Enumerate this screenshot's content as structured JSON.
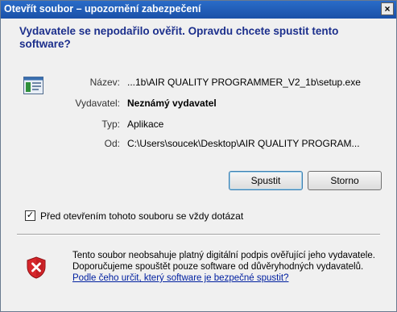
{
  "window": {
    "title": "Otevřít soubor – upozornění zabezpečení",
    "close_glyph": "×"
  },
  "question": "Vydavatele se nepodařilo ověřit. Opravdu chcete spustit tento software?",
  "details": {
    "name_label": "Název:",
    "name_value": "...1b\\AIR QUALITY PROGRAMMER_V2_1b\\setup.exe",
    "publisher_label": "Vydavatel:",
    "publisher_value": "Neznámý vydavatel",
    "type_label": "Typ:",
    "type_value": "Aplikace",
    "from_label": "Od:",
    "from_value": "C:\\Users\\soucek\\Desktop\\AIR QUALITY PROGRAM..."
  },
  "buttons": {
    "run_label": "Spustit",
    "cancel_label": "Storno"
  },
  "checkbox": {
    "label": "Před otevřením tohoto souboru se vždy dotázat",
    "checked": true,
    "check_glyph": "✓"
  },
  "warning": {
    "text": "Tento soubor neobsahuje platný digitální podpis ověřující jeho vydavatele. Doporučujeme spouštět pouze software od důvěryhodných vydavatelů. ",
    "link_text": "Podle čeho určit, který software je bezpečné spustit?"
  },
  "icons": {
    "file": "application-file-icon",
    "warning": "security-shield-warning-icon",
    "close": "close-icon"
  },
  "colors": {
    "title_bar": "#1a50a8",
    "question_text": "#1c2f8c",
    "link": "#0020a0",
    "shield_red": "#d7262b"
  }
}
